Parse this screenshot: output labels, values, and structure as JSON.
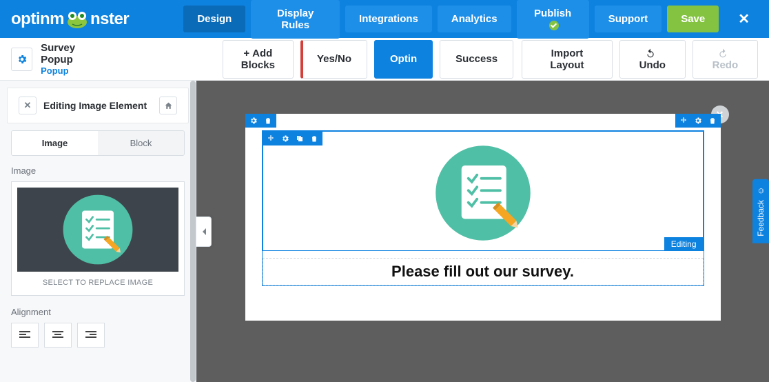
{
  "brand": "optinmonster",
  "nav": {
    "design": "Design",
    "display_rules": "Display Rules",
    "integrations": "Integrations",
    "analytics": "Analytics",
    "publish": "Publish",
    "support": "Support",
    "save": "Save"
  },
  "campaign": {
    "title": "Survey Popup",
    "type": "Popup"
  },
  "toolbar": {
    "add_blocks": "Add Blocks",
    "yes_no": "Yes/No",
    "optin": "Optin",
    "success": "Success",
    "import_layout": "Import Layout",
    "undo": "Undo",
    "redo": "Redo"
  },
  "sidebar": {
    "title": "Editing Image Element",
    "tabs": {
      "image": "Image",
      "block": "Block"
    },
    "image_label": "Image",
    "replace_text": "SELECT TO REPLACE IMAGE",
    "alignment_label": "Alignment"
  },
  "popup": {
    "headline": "Please fill out our survey.",
    "editing_badge": "Editing"
  },
  "feedback": "Feedback",
  "colors": {
    "primary": "#0d82df",
    "accent": "#84c341",
    "teal": "#4fbfa5"
  }
}
